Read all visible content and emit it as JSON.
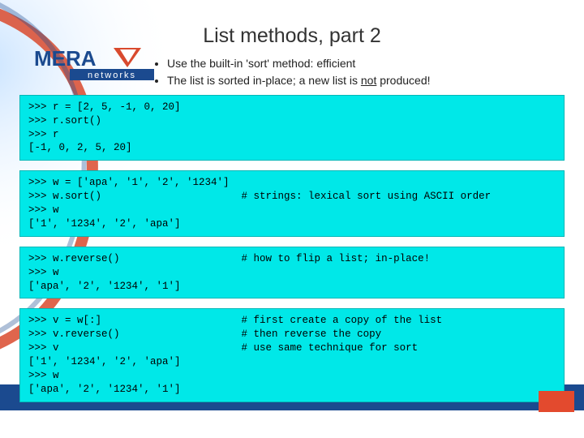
{
  "title": "List methods, part 2",
  "logo": {
    "main": "MERA",
    "sub": "networks"
  },
  "bullets": [
    {
      "text": "Use the built-in 'sort' method: efficient"
    },
    {
      "pre": "The list is sorted in-place; a new list is ",
      "u": "not",
      "post": " produced!"
    }
  ],
  "code": [
    ">>> r = [2, 5, -1, 0, 20]\n>>> r.sort()\n>>> r\n[-1, 0, 2, 5, 20]",
    ">>> w = ['apa', '1', '2', '1234']\n>>> w.sort()                       # strings: lexical sort using ASCII order\n>>> w\n['1', '1234', '2', 'apa']",
    ">>> w.reverse()                    # how to flip a list; in-place!\n>>> w\n['apa', '2', '1234', '1']",
    ">>> v = w[:]                       # first create a copy of the list\n>>> v.reverse()                    # then reverse the copy\n>>> v                              # use same technique for sort\n['1', '1234', '2', 'apa']\n>>> w\n['apa', '2', '1234', '1']"
  ]
}
